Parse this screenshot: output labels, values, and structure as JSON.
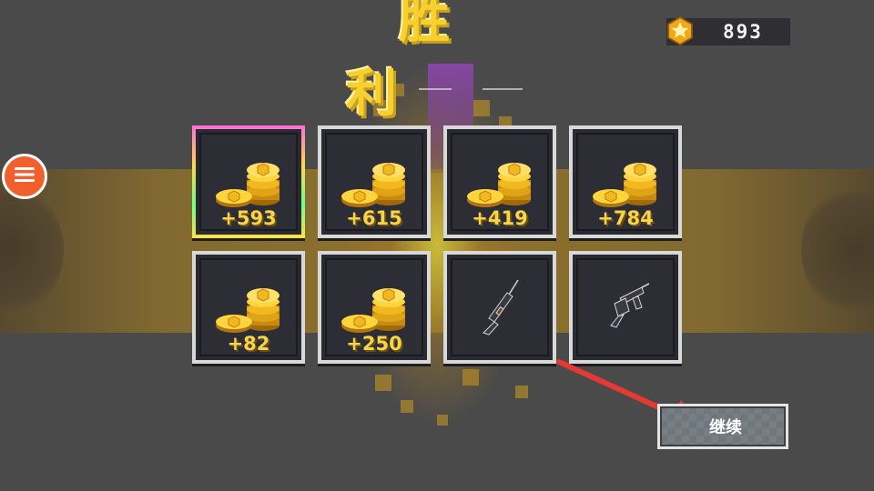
{
  "header": {
    "title": "胜 利"
  },
  "currency": {
    "icon": "star-coin-icon",
    "value": "893"
  },
  "menu": {
    "icon": "hamburger-menu-icon"
  },
  "rewards": [
    {
      "type": "coins",
      "icon": "gold-coin-stack-icon",
      "amount": "+593",
      "highlighted": true
    },
    {
      "type": "coins",
      "icon": "gold-coin-stack-icon",
      "amount": "+615"
    },
    {
      "type": "coins",
      "icon": "gold-coin-stack-icon",
      "amount": "+419"
    },
    {
      "type": "coins",
      "icon": "gold-coin-stack-icon",
      "amount": "+784"
    },
    {
      "type": "coins",
      "icon": "gold-coin-stack-icon",
      "amount": "+82"
    },
    {
      "type": "coins",
      "icon": "gold-coin-stack-icon",
      "amount": "+250"
    },
    {
      "type": "weapon",
      "icon": "rifle-outline-icon"
    },
    {
      "type": "weapon",
      "icon": "smg-outline-icon"
    }
  ],
  "actions": {
    "continue_label": "继续"
  },
  "colors": {
    "title": "#f7d030",
    "menu_button": "#f15f2c",
    "amount_text": "#f7d448",
    "pointer_arrow": "#e53935"
  }
}
